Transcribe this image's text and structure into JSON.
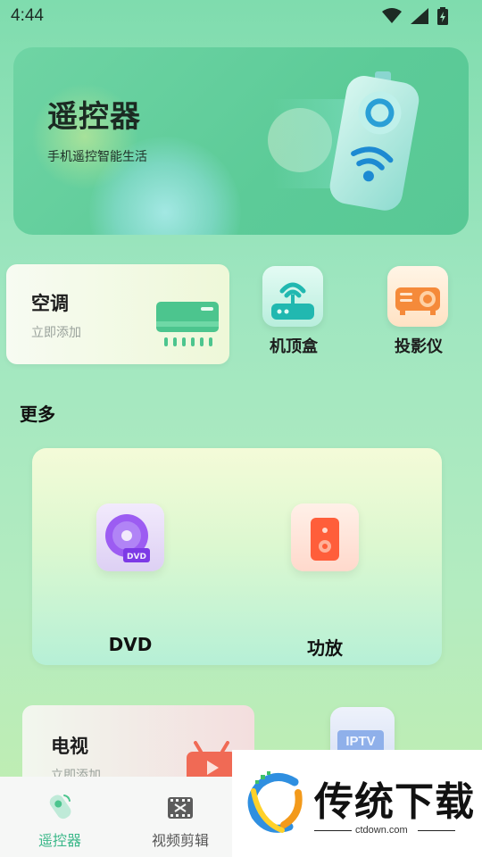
{
  "status_bar": {
    "time": "4:44"
  },
  "banner": {
    "title": "遥控器",
    "subtitle": "手机遥控智能生活"
  },
  "devices": {
    "ac": {
      "title": "空调",
      "subtitle": "立即添加"
    },
    "set_top_box": {
      "label": "机顶盒"
    },
    "projector": {
      "label": "投影仪"
    }
  },
  "more": {
    "title": "更多",
    "items": [
      {
        "label": "DVD"
      },
      {
        "label": "功放"
      }
    ]
  },
  "tv": {
    "title": "电视",
    "subtitle": "立即添加",
    "iptv_badge": "IPTV"
  },
  "bottom_nav": {
    "items": [
      {
        "label": "遥控器",
        "active": true
      },
      {
        "label": "视频剪辑",
        "active": false
      }
    ]
  },
  "watermark": {
    "text": "传统下载",
    "url": "ctdown.com"
  },
  "colors": {
    "accent": "#3cb88a",
    "inactive": "#555555"
  }
}
